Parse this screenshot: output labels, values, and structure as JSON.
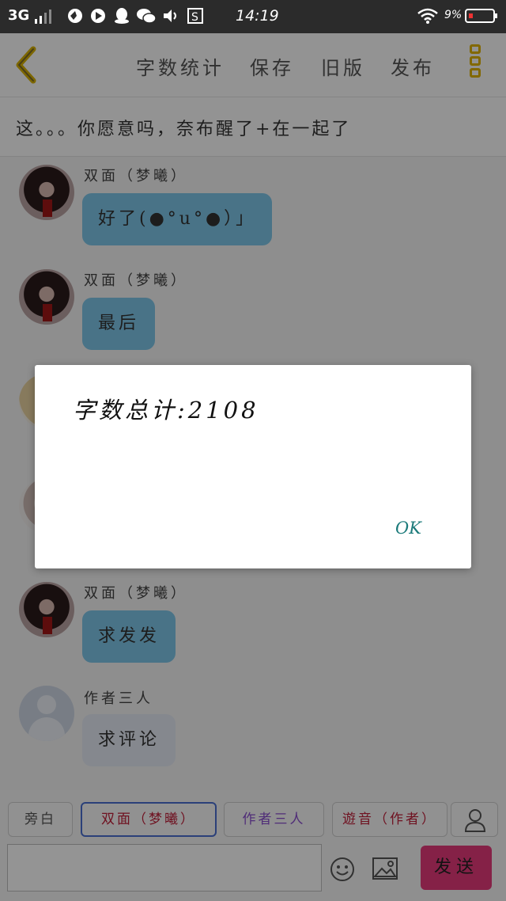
{
  "status_bar": {
    "network": "3G",
    "time": "14:19",
    "battery": "9%",
    "icons": [
      "signal-icon",
      "browser-icon",
      "video-icon",
      "qq-icon",
      "wechat-icon",
      "volume-icon",
      "s-icon",
      "wifi-icon",
      "battery-icon"
    ]
  },
  "header": {
    "back_icon": "chevron-left-icon",
    "buttons": [
      "字数统计",
      "保存",
      "旧版",
      "发布"
    ],
    "menu_icon": "menu-icon",
    "accent": "#e0b400"
  },
  "topic": "这。。。你愿意吗，奈布醒了+在一起了",
  "chat": {
    "messages": [
      {
        "sender": "双面（梦曦）",
        "text": "好了(●°u°●）」"
      },
      {
        "sender": "双面（梦曦）",
        "text": "最后"
      },
      {
        "sender": "双面（梦曦）",
        "text": "求发发"
      },
      {
        "sender": "作者三人",
        "text": "求评论"
      }
    ]
  },
  "roles": [
    {
      "label": "旁白",
      "color": "#555555"
    },
    {
      "label": "双面（梦曦）",
      "color": "#c0203a"
    },
    {
      "label": "作者三人",
      "color": "#8a4fcf"
    },
    {
      "label": "遊音（作者）",
      "color": "#c0203a"
    }
  ],
  "input": {
    "placeholder": ""
  },
  "send_label": "发送",
  "send_color": "#e5397a",
  "dialog": {
    "message": "字数总计:2108",
    "ok": "OK"
  }
}
